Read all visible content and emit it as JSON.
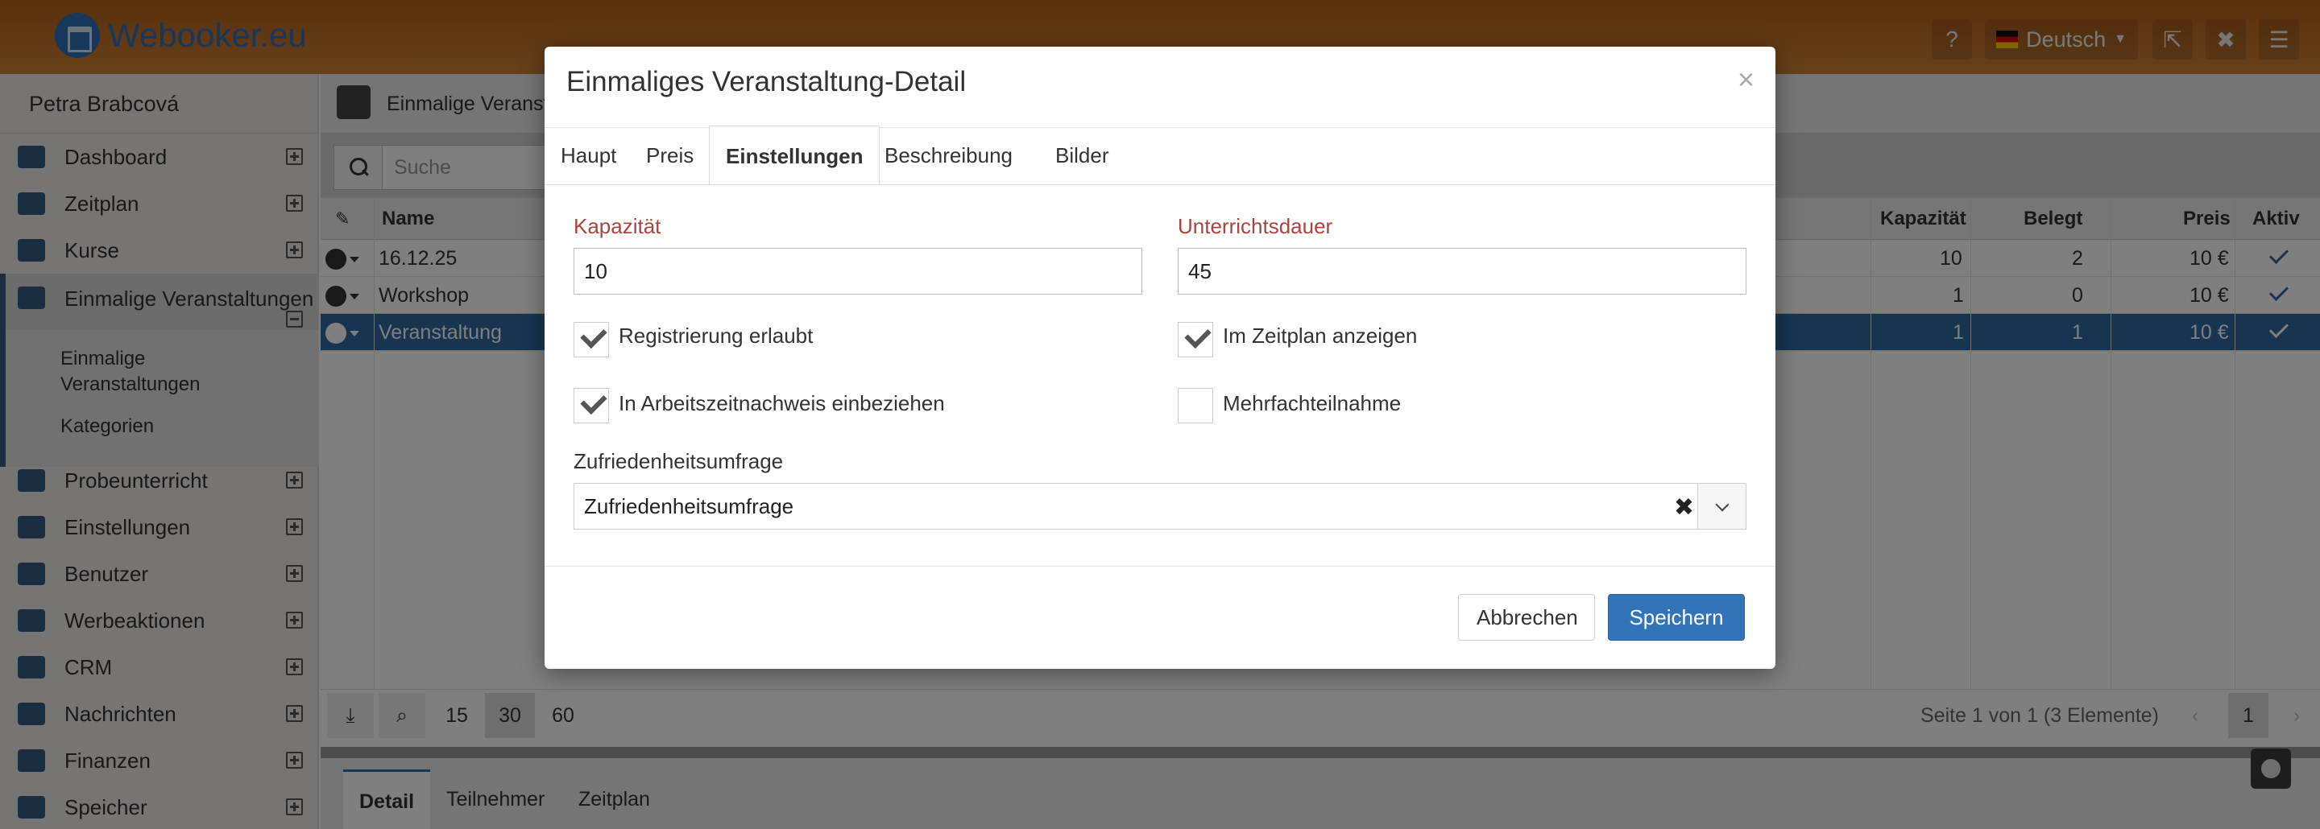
{
  "app": {
    "logo_text": "Webooker.eu",
    "language": "Deutsch"
  },
  "sidebar": {
    "user_name": "Petra Brabcová",
    "items": [
      {
        "label": "Dashboard",
        "icon": "home-icon"
      },
      {
        "label": "Zeitplan",
        "icon": "calendar-icon"
      },
      {
        "label": "Kurse",
        "icon": "book-icon"
      },
      {
        "label": "Einmalige Veranstaltungen",
        "icon": "globe-icon"
      },
      {
        "label": "Probeunterricht",
        "icon": "eye-icon"
      },
      {
        "label": "Einstellungen",
        "icon": "settings-icon"
      },
      {
        "label": "Benutzer",
        "icon": "users-icon"
      },
      {
        "label": "Werbeaktionen",
        "icon": "gift-icon"
      },
      {
        "label": "CRM",
        "icon": "handshake-icon"
      },
      {
        "label": "Nachrichten",
        "icon": "envelope-icon"
      },
      {
        "label": "Finanzen",
        "icon": "money-icon"
      },
      {
        "label": "Speicher",
        "icon": "database-icon"
      }
    ],
    "subitems": [
      "Einmalige Veranstaltungen",
      "Kategorien"
    ]
  },
  "main": {
    "header_title": "Einmalige Veranst",
    "search_placeholder": "Suche",
    "columns": {
      "name": "Name",
      "kapazitaet": "Kapazität",
      "belegt": "Belegt",
      "preis": "Preis",
      "aktiv": "Aktiv"
    },
    "rows": [
      {
        "name": "16.12.25",
        "kapazitaet": "10",
        "belegt": "2",
        "preis": "10 €"
      },
      {
        "name": "Workshop",
        "kapazitaet": "1",
        "belegt": "0",
        "preis": "10 €"
      },
      {
        "name": "Veranstaltung",
        "kapazitaet": "1",
        "belegt": "1",
        "preis": "10 €"
      }
    ],
    "page_sizes": [
      "15",
      "30",
      "60"
    ],
    "pager_info": "Seite 1 von 1 (3 Elemente)",
    "current_page": "1",
    "bottom_tabs": [
      "Detail",
      "Teilnehmer",
      "Zeitplan"
    ]
  },
  "modal": {
    "title": "Einmaliges Veranstaltung-Detail",
    "close": "×",
    "tabs": [
      "Haupt",
      "Preis",
      "Einstellungen",
      "Beschreibung",
      "Bilder"
    ],
    "active_tab": "Einstellungen",
    "kapazitaet_label": "Kapazität",
    "kapazitaet_value": "10",
    "dauer_label": "Unterrichtsdauer",
    "dauer_value": "45",
    "checkboxes": [
      {
        "label": "Registrierung erlaubt",
        "checked": true
      },
      {
        "label": "Im Zeitplan anzeigen",
        "checked": true
      },
      {
        "label": "In Arbeitszeitnachweis einbeziehen",
        "checked": true
      },
      {
        "label": "Mehrfachteilnahme",
        "checked": false
      }
    ],
    "survey_label": "Zufriedenheitsumfrage",
    "survey_value": "Zufriedenheitsumfrage",
    "cancel_label": "Abbrechen",
    "save_label": "Speichern"
  }
}
